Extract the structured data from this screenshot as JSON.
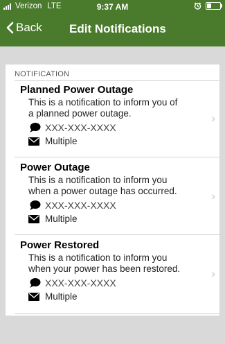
{
  "status_bar": {
    "carrier": "Verizon",
    "network": "LTE",
    "time": "9:37 AM"
  },
  "nav": {
    "back_label": "Back",
    "title": "Edit Notifications"
  },
  "section": {
    "header": "NOTIFICATION"
  },
  "notifications": [
    {
      "title": "Planned Power Outage",
      "description_lines": [
        "This is a notification to inform you of",
        "a planned power outage."
      ],
      "phone": "XXX-XXX-XXXX",
      "email": "Multiple"
    },
    {
      "title": "Power Outage",
      "description_lines": [
        "This is a notification to inform you",
        "when a power outage has occurred."
      ],
      "phone": "XXX-XXX-XXXX",
      "email": "Multiple"
    },
    {
      "title": "Power Restored",
      "description_lines": [
        "This is a notification to inform you",
        "when your power has been restored."
      ],
      "phone": "XXX-XXX-XXXX",
      "email": "Multiple"
    }
  ],
  "colors": {
    "header_bg": "#4a7a2c",
    "page_bg": "#d9d9d9",
    "card_bg": "#ffffff"
  }
}
